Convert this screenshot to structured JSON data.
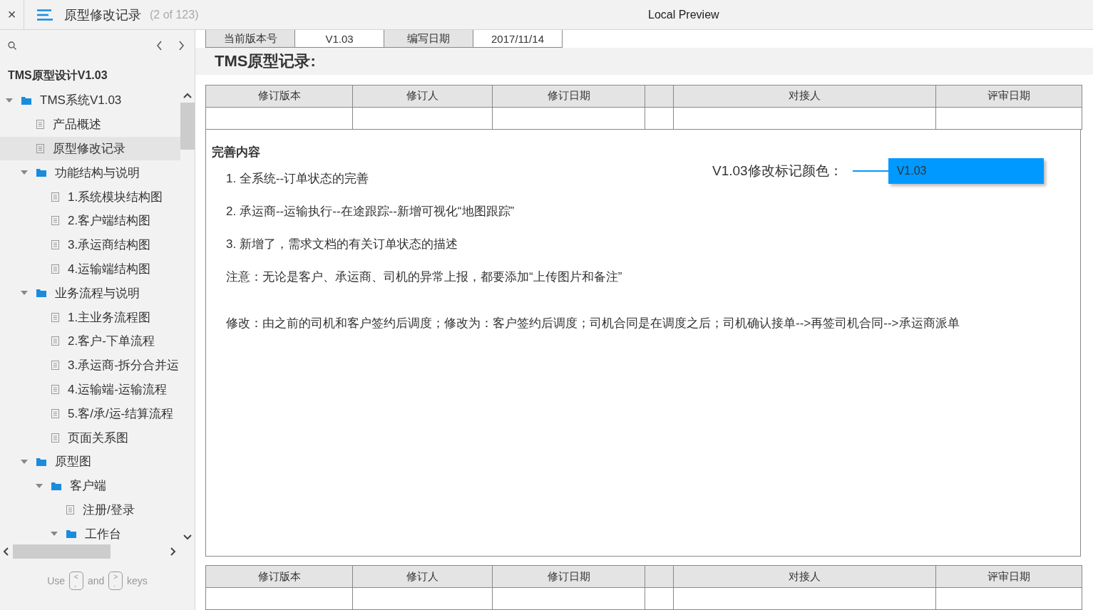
{
  "topbar": {
    "close": "×",
    "title": "原型修改记录",
    "count": "(2 of 123)",
    "preview": "Local Preview"
  },
  "sidebar": {
    "project": "TMS原型设计V1.03",
    "tree": [
      {
        "kind": "folder",
        "label": "TMS系统V1.03",
        "expanded": true,
        "selected": false,
        "children": [
          {
            "kind": "page",
            "label": "产品概述",
            "selected": false
          },
          {
            "kind": "page",
            "label": "原型修改记录",
            "selected": true
          },
          {
            "kind": "folder",
            "label": "功能结构与说明",
            "expanded": true,
            "selected": false,
            "children": [
              {
                "kind": "page",
                "label": "1.系统模块结构图",
                "selected": false
              },
              {
                "kind": "page",
                "label": "2.客户端结构图",
                "selected": false
              },
              {
                "kind": "page",
                "label": "3.承运商结构图",
                "selected": false
              },
              {
                "kind": "page",
                "label": "4.运输端结构图",
                "selected": false
              }
            ]
          },
          {
            "kind": "folder",
            "label": "业务流程与说明",
            "expanded": true,
            "selected": false,
            "children": [
              {
                "kind": "page",
                "label": "1.主业务流程图",
                "selected": false
              },
              {
                "kind": "page",
                "label": "2.客户-下单流程",
                "selected": false
              },
              {
                "kind": "page",
                "label": "3.承运商-拆分合并运",
                "selected": false
              },
              {
                "kind": "page",
                "label": "4.运输端-运输流程",
                "selected": false
              },
              {
                "kind": "page",
                "label": "5.客/承/运-结算流程",
                "selected": false
              },
              {
                "kind": "page",
                "label": "页面关系图",
                "selected": false
              }
            ]
          },
          {
            "kind": "folder",
            "label": "原型图",
            "expanded": true,
            "selected": false,
            "children": [
              {
                "kind": "folder",
                "label": "客户端",
                "expanded": true,
                "selected": false,
                "children": [
                  {
                    "kind": "page",
                    "label": "注册/登录",
                    "selected": false
                  },
                  {
                    "kind": "folder",
                    "label": "工作台",
                    "expanded": true,
                    "selected": false
                  }
                ]
              }
            ]
          }
        ]
      }
    ],
    "hint": {
      "use": "Use",
      "key1": "<\n,",
      "and": "and",
      "key2": ">\n.",
      "keys": "keys"
    }
  },
  "doc": {
    "meta": [
      {
        "kind": "label",
        "text": "当前版本号"
      },
      {
        "kind": "value",
        "text": "V1.03"
      },
      {
        "kind": "label",
        "text": "编写日期"
      },
      {
        "kind": "value",
        "text": "2017/11/14"
      }
    ],
    "heading": "TMS原型记录:",
    "table_columns": [
      "修订版本",
      "修订人",
      "修订日期",
      "",
      "对接人",
      "评审日期"
    ],
    "content_title": "完善内容",
    "items": [
      "1. 全系统--订单状态的完善",
      "2. 承运商--运输执行--在途跟踪--新增可视化“地图跟踪”",
      "3. 新增了，需求文档的有关订单状态的描述",
      "注意：无论是客户、承运商、司机的异常上报，都要添加“上传图片和备注”"
    ],
    "modification": "修改：由之前的司机和客户签约后调度；修改为：客户签约后调度；司机合同是在调度之后；司机确认接单-->再签司机合同-->承运商派单",
    "legend_label": "V1.03修改标记颜色：",
    "legend_tag": "V1.03",
    "table2_columns": [
      "修订版本",
      "修订人",
      "修订日期",
      "",
      "对接人",
      "评审日期"
    ]
  }
}
